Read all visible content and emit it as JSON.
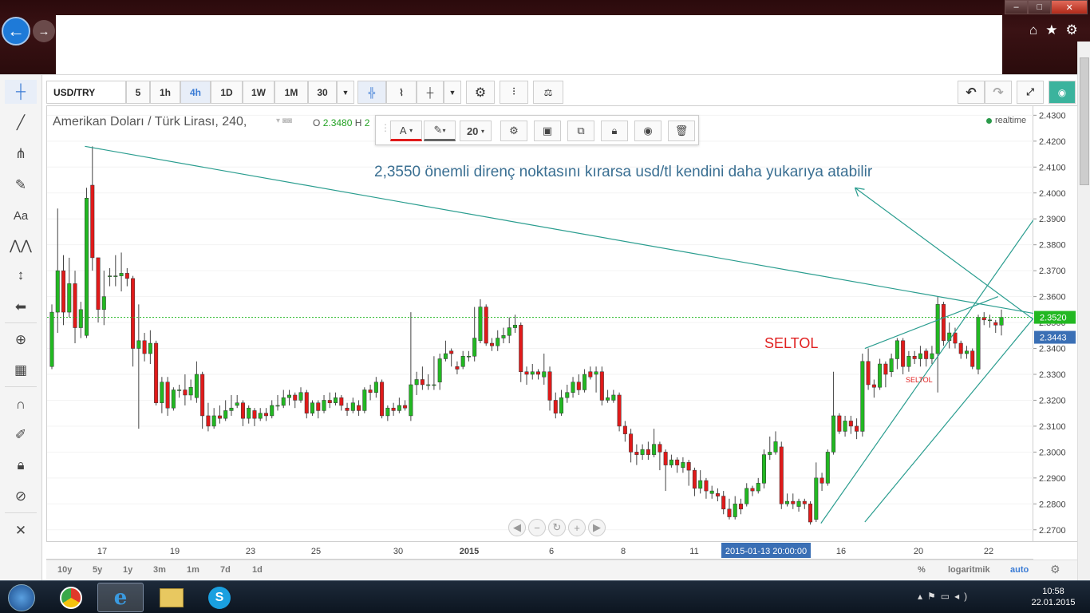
{
  "toolbar": {
    "symbol": "USD/TRY",
    "intervals": [
      "5",
      "1h",
      "4h",
      "1D",
      "1W",
      "1M",
      "30"
    ],
    "active_interval": "4h"
  },
  "legend": {
    "title": "Amerikan Doları / Türk Lirası, 240,",
    "ohlc_o_label": "O",
    "ohlc_o": "2.3480",
    "ohlc_h_label": "H",
    "ohlc_h": "2"
  },
  "draw_toolbar": {
    "font_size": "20",
    "text_label": "A"
  },
  "status": {
    "realtime": "realtime"
  },
  "ranges": [
    "10y",
    "5y",
    "1y",
    "3m",
    "1m",
    "7d",
    "1d"
  ],
  "bottom_right": {
    "percent": "%",
    "log": "logaritmik",
    "auto": "auto"
  },
  "taskbar": {
    "time": "10:58",
    "date": "22.01.2015"
  },
  "chart_data": {
    "type": "candlestick",
    "title": "Amerikan Doları / Türk Lirası, 240,",
    "y_ticks": [
      "2.4300",
      "2.4200",
      "2.4100",
      "2.4000",
      "2.3900",
      "2.3800",
      "2.3700",
      "2.3600",
      "2.3500",
      "2.3400",
      "2.3300",
      "2.3200",
      "2.3100",
      "2.3000",
      "2.2900",
      "2.2800",
      "2.2700"
    ],
    "ylim": [
      2.265,
      2.4335
    ],
    "x_ticks": [
      "17",
      "19",
      "23",
      "25",
      "30",
      "2015",
      "6",
      "8",
      "11",
      "16",
      "20",
      "22"
    ],
    "x_bold_tick": "2015",
    "crosshair_time": "2015-01-13 20:00:00",
    "current_price_label": "2.3520",
    "last_price_label": "2.3443",
    "annotations": [
      "2,3550 önemli direnç noktasını kırarsa usd/tl kendini daha yukarıya atabilir",
      "SELTOL",
      "SELTOL"
    ],
    "colors": {
      "up": "#22b822",
      "down": "#e01a1a",
      "trendline": "#2a9d8f",
      "price_line": "#22b822",
      "annotation": "#3a6f92",
      "seltol": "#e02020"
    },
    "candles": [
      [
        2.333,
        2.354,
        2.357,
        2.332
      ],
      [
        2.354,
        2.37,
        2.394,
        2.346
      ],
      [
        2.37,
        2.354,
        2.376,
        2.349
      ],
      [
        2.354,
        2.365,
        2.375,
        2.352
      ],
      [
        2.365,
        2.348,
        2.37,
        2.342
      ],
      [
        2.348,
        2.355,
        2.358,
        2.344
      ],
      [
        2.345,
        2.398,
        2.402,
        2.344
      ],
      [
        2.403,
        2.375,
        2.418,
        2.37
      ],
      [
        2.375,
        2.355,
        2.374,
        2.35
      ],
      [
        2.355,
        2.36,
        2.37,
        2.349
      ],
      [
        2.368,
        2.368,
        2.371,
        2.364
      ],
      [
        2.368,
        2.368,
        2.376,
        2.364
      ],
      [
        2.368,
        2.369,
        2.377,
        2.362
      ],
      [
        2.369,
        2.367,
        2.371,
        2.364
      ],
      [
        2.367,
        2.34,
        2.368,
        2.333
      ],
      [
        2.34,
        2.343,
        2.357,
        2.309
      ],
      [
        2.343,
        2.338,
        2.346,
        2.335
      ],
      [
        2.338,
        2.342,
        2.347,
        2.334
      ],
      [
        2.342,
        2.319,
        2.343,
        2.318
      ],
      [
        2.319,
        2.327,
        2.329,
        2.315
      ],
      [
        2.327,
        2.317,
        2.329,
        2.314
      ],
      [
        2.317,
        2.324,
        2.325,
        2.316
      ],
      [
        2.324,
        2.324,
        2.326,
        2.321
      ],
      [
        2.324,
        2.322,
        2.33,
        2.318
      ],
      [
        2.322,
        2.325,
        2.328,
        2.32
      ],
      [
        2.321,
        2.33,
        2.335,
        2.319
      ],
      [
        2.33,
        2.314,
        2.331,
        2.309
      ],
      [
        2.314,
        2.31,
        2.319,
        2.308
      ],
      [
        2.31,
        2.314,
        2.317,
        2.309
      ],
      [
        2.314,
        2.313,
        2.318,
        2.311
      ],
      [
        2.313,
        2.316,
        2.32,
        2.312
      ],
      [
        2.316,
        2.317,
        2.322,
        2.314
      ],
      [
        2.318,
        2.319,
        2.322,
        2.317
      ],
      [
        2.319,
        2.313,
        2.32,
        2.31
      ],
      [
        2.313,
        2.317,
        2.318,
        2.311
      ],
      [
        2.316,
        2.313,
        2.317,
        2.31
      ],
      [
        2.313,
        2.315,
        2.317,
        2.312
      ],
      [
        2.315,
        2.314,
        2.317,
        2.312
      ],
      [
        2.314,
        2.318,
        2.32,
        2.313
      ],
      [
        2.318,
        2.318,
        2.322,
        2.316
      ],
      [
        2.318,
        2.321,
        2.324,
        2.317
      ],
      [
        2.321,
        2.322,
        2.324,
        2.318
      ],
      [
        2.322,
        2.32,
        2.323,
        2.317
      ],
      [
        2.32,
        2.323,
        2.325,
        2.319
      ],
      [
        2.323,
        2.315,
        2.324,
        2.313
      ],
      [
        2.315,
        2.319,
        2.32,
        2.314
      ],
      [
        2.319,
        2.316,
        2.32,
        2.313
      ],
      [
        2.316,
        2.32,
        2.322,
        2.315
      ],
      [
        2.32,
        2.319,
        2.323,
        2.317
      ],
      [
        2.319,
        2.321,
        2.323,
        2.318
      ],
      [
        2.321,
        2.318,
        2.322,
        2.316
      ],
      [
        2.317,
        2.316,
        2.319,
        2.314
      ],
      [
        2.316,
        2.319,
        2.321,
        2.315
      ],
      [
        2.318,
        2.316,
        2.32,
        2.314
      ],
      [
        2.316,
        2.324,
        2.325,
        2.315
      ],
      [
        2.324,
        2.323,
        2.326,
        2.32
      ],
      [
        2.323,
        2.327,
        2.329,
        2.321
      ],
      [
        2.327,
        2.314,
        2.328,
        2.313
      ],
      [
        2.314,
        2.317,
        2.318,
        2.312
      ],
      [
        2.317,
        2.316,
        2.319,
        2.314
      ],
      [
        2.316,
        2.318,
        2.321,
        2.315
      ],
      [
        2.318,
        2.317,
        2.32,
        2.316
      ],
      [
        2.314,
        2.326,
        2.354,
        2.312
      ],
      [
        2.326,
        2.328,
        2.331,
        2.322
      ],
      [
        2.328,
        2.326,
        2.333,
        2.324
      ],
      [
        2.326,
        2.326,
        2.33,
        2.324
      ],
      [
        2.326,
        2.326,
        2.337,
        2.324
      ],
      [
        2.327,
        2.336,
        2.338,
        2.324
      ],
      [
        2.336,
        2.338,
        2.343,
        2.335
      ],
      [
        2.339,
        2.338,
        2.34,
        2.333
      ],
      [
        2.333,
        2.332,
        2.335,
        2.33
      ],
      [
        2.333,
        2.337,
        2.339,
        2.332
      ],
      [
        2.337,
        2.337,
        2.339,
        2.335
      ],
      [
        2.337,
        2.344,
        2.356,
        2.335
      ],
      [
        2.343,
        2.356,
        2.359,
        2.342
      ],
      [
        2.356,
        2.342,
        2.357,
        2.341
      ],
      [
        2.342,
        2.341,
        2.344,
        2.339
      ],
      [
        2.341,
        2.344,
        2.347,
        2.339
      ],
      [
        2.344,
        2.345,
        2.348,
        2.342
      ],
      [
        2.345,
        2.348,
        2.352,
        2.342
      ],
      [
        2.348,
        2.349,
        2.353,
        2.346
      ],
      [
        2.349,
        2.331,
        2.35,
        2.327
      ],
      [
        2.331,
        2.33,
        2.333,
        2.326
      ],
      [
        2.33,
        2.331,
        2.334,
        2.328
      ],
      [
        2.331,
        2.33,
        2.332,
        2.328
      ],
      [
        2.329,
        2.331,
        2.338,
        2.326
      ],
      [
        2.331,
        2.32,
        2.333,
        2.316
      ],
      [
        2.32,
        2.315,
        2.323,
        2.313
      ],
      [
        2.315,
        2.321,
        2.324,
        2.314
      ],
      [
        2.321,
        2.323,
        2.326,
        2.319
      ],
      [
        2.323,
        2.327,
        2.329,
        2.321
      ],
      [
        2.327,
        2.324,
        2.33,
        2.322
      ],
      [
        2.324,
        2.33,
        2.332,
        2.323
      ],
      [
        2.331,
        2.329,
        2.333,
        2.328
      ],
      [
        2.33,
        2.331,
        2.333,
        2.323
      ],
      [
        2.331,
        2.32,
        2.333,
        2.318
      ],
      [
        2.32,
        2.321,
        2.324,
        2.319
      ],
      [
        2.32,
        2.322,
        2.324,
        2.319
      ],
      [
        2.322,
        2.31,
        2.323,
        2.308
      ],
      [
        2.31,
        2.307,
        2.312,
        2.304
      ],
      [
        2.307,
        2.3,
        2.309,
        2.296
      ],
      [
        2.3,
        2.299,
        2.303,
        2.295
      ],
      [
        2.299,
        2.301,
        2.303,
        2.297
      ],
      [
        2.301,
        2.299,
        2.304,
        2.297
      ],
      [
        2.299,
        2.303,
        2.309,
        2.298
      ],
      [
        2.303,
        2.3,
        2.304,
        2.293
      ],
      [
        2.3,
        2.295,
        2.301,
        2.285
      ],
      [
        2.295,
        2.297,
        2.299,
        2.294
      ],
      [
        2.297,
        2.295,
        2.298,
        2.292
      ],
      [
        2.294,
        2.296,
        2.298,
        2.292
      ],
      [
        2.296,
        2.293,
        2.297,
        2.287
      ],
      [
        2.293,
        2.286,
        2.294,
        2.283
      ],
      [
        2.286,
        2.289,
        2.293,
        2.284
      ],
      [
        2.289,
        2.285,
        2.29,
        2.282
      ],
      [
        2.284,
        2.285,
        2.287,
        2.282
      ],
      [
        2.284,
        2.283,
        2.286,
        2.281
      ],
      [
        2.283,
        2.278,
        2.285,
        2.276
      ],
      [
        2.278,
        2.275,
        2.282,
        2.274
      ],
      [
        2.275,
        2.28,
        2.283,
        2.274
      ],
      [
        2.28,
        2.278,
        2.282,
        2.276
      ],
      [
        2.28,
        2.286,
        2.288,
        2.279
      ],
      [
        2.286,
        2.285,
        2.287,
        2.283
      ],
      [
        2.285,
        2.288,
        2.29,
        2.284
      ],
      [
        2.288,
        2.299,
        2.301,
        2.286
      ],
      [
        2.299,
        2.3,
        2.306,
        2.297
      ],
      [
        2.3,
        2.304,
        2.308,
        2.299
      ],
      [
        2.302,
        2.28,
        2.304,
        2.278
      ],
      [
        2.28,
        2.281,
        2.284,
        2.279
      ],
      [
        2.281,
        2.28,
        2.284,
        2.278
      ],
      [
        2.279,
        2.281,
        2.282,
        2.277
      ],
      [
        2.281,
        2.28,
        2.282,
        2.278
      ],
      [
        2.28,
        2.273,
        2.281,
        2.272
      ],
      [
        2.274,
        2.29,
        2.296,
        2.273
      ],
      [
        2.29,
        2.288,
        2.292,
        2.285
      ],
      [
        2.288,
        2.3,
        2.301,
        2.287
      ],
      [
        2.3,
        2.314,
        2.331,
        2.299
      ],
      [
        2.314,
        2.308,
        2.315,
        2.307
      ],
      [
        2.308,
        2.312,
        2.314,
        2.306
      ],
      [
        2.312,
        2.31,
        2.314,
        2.307
      ],
      [
        2.31,
        2.308,
        2.313,
        2.305
      ],
      [
        2.308,
        2.335,
        2.338,
        2.306
      ],
      [
        2.335,
        2.326,
        2.34,
        2.324
      ],
      [
        2.326,
        2.325,
        2.328,
        2.321
      ],
      [
        2.325,
        2.334,
        2.336,
        2.324
      ],
      [
        2.334,
        2.33,
        2.335,
        2.325
      ],
      [
        2.331,
        2.336,
        2.338,
        2.329
      ],
      [
        2.336,
        2.343,
        2.344,
        2.332
      ],
      [
        2.343,
        2.333,
        2.344,
        2.33
      ],
      [
        2.333,
        2.337,
        2.339,
        2.331
      ],
      [
        2.337,
        2.336,
        2.339,
        2.334
      ],
      [
        2.336,
        2.338,
        2.341,
        2.333
      ],
      [
        2.339,
        2.336,
        2.34,
        2.333
      ],
      [
        2.336,
        2.338,
        2.341,
        2.334
      ],
      [
        2.338,
        2.357,
        2.36,
        2.323
      ],
      [
        2.357,
        2.343,
        2.358,
        2.341
      ],
      [
        2.343,
        2.346,
        2.35,
        2.34
      ],
      [
        2.346,
        2.342,
        2.348,
        2.34
      ],
      [
        2.342,
        2.338,
        2.343,
        2.336
      ],
      [
        2.338,
        2.339,
        2.341,
        2.336
      ],
      [
        2.339,
        2.333,
        2.34,
        2.332
      ],
      [
        2.332,
        2.352,
        2.353,
        2.33
      ],
      [
        2.352,
        2.351,
        2.354,
        2.349
      ],
      [
        2.351,
        2.351,
        2.353,
        2.348
      ],
      [
        2.35,
        2.349,
        2.351,
        2.346
      ],
      [
        2.349,
        2.352,
        2.355,
        2.345
      ]
    ],
    "trendlines": [
      {
        "from": [
          0.0383,
          2.418
        ],
        "to": [
          1.0,
          2.3535
        ]
      },
      {
        "from": [
          0.784,
          2.2725
        ],
        "to": [
          1.0,
          2.39
        ]
      },
      {
        "from": [
          0.8285,
          2.273
        ],
        "to": [
          1.0,
          2.352
        ]
      },
      {
        "from": [
          0.8285,
          2.34
        ],
        "to": [
          0.9635,
          2.36
        ]
      },
      {
        "from": [
          0.8185,
          2.402
        ],
        "to": [
          1.0,
          2.351
        ]
      }
    ]
  }
}
